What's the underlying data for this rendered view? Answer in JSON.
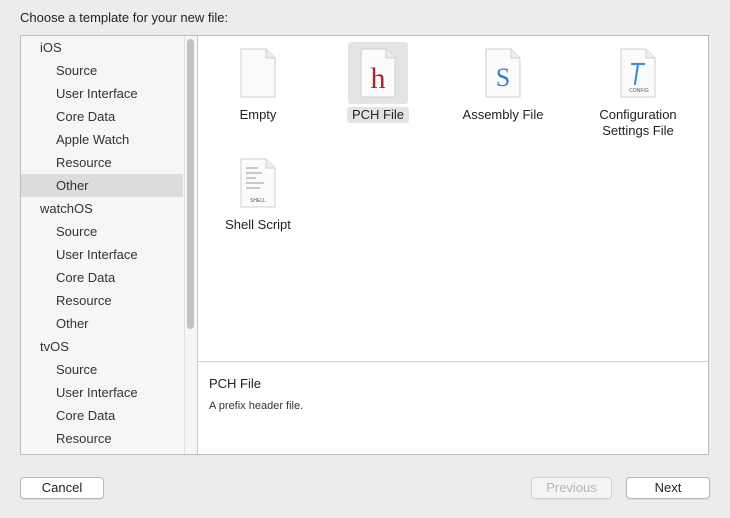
{
  "prompt": "Choose a template for your new file:",
  "sidebar": {
    "items": [
      {
        "label": "iOS",
        "level": 0
      },
      {
        "label": "Source",
        "level": 1
      },
      {
        "label": "User Interface",
        "level": 1
      },
      {
        "label": "Core Data",
        "level": 1
      },
      {
        "label": "Apple Watch",
        "level": 1
      },
      {
        "label": "Resource",
        "level": 1
      },
      {
        "label": "Other",
        "level": 1,
        "selected": true
      },
      {
        "label": "watchOS",
        "level": 0
      },
      {
        "label": "Source",
        "level": 1
      },
      {
        "label": "User Interface",
        "level": 1
      },
      {
        "label": "Core Data",
        "level": 1
      },
      {
        "label": "Resource",
        "level": 1
      },
      {
        "label": "Other",
        "level": 1
      },
      {
        "label": "tvOS",
        "level": 0
      },
      {
        "label": "Source",
        "level": 1
      },
      {
        "label": "User Interface",
        "level": 1
      },
      {
        "label": "Core Data",
        "level": 1
      },
      {
        "label": "Resource",
        "level": 1
      }
    ]
  },
  "templates": [
    {
      "label": "Empty",
      "icon": "empty-file-icon"
    },
    {
      "label": "PCH File",
      "icon": "pch-file-icon",
      "glyph": "h",
      "glyph_color": "#a32634",
      "selected": true
    },
    {
      "label": "Assembly File",
      "icon": "assembly-file-icon",
      "glyph": "S",
      "glyph_color": "#3b7bd1"
    },
    {
      "label": "Configuration Settings File",
      "icon": "config-file-icon",
      "glyph": "CONFIG",
      "glyph_color": "#3a8fd6"
    },
    {
      "label": "Shell Script",
      "icon": "shell-script-icon",
      "glyph": "SHELL"
    }
  ],
  "description": {
    "title": "PCH File",
    "text": "A prefix header file."
  },
  "buttons": {
    "cancel": "Cancel",
    "previous": "Previous",
    "next": "Next"
  }
}
